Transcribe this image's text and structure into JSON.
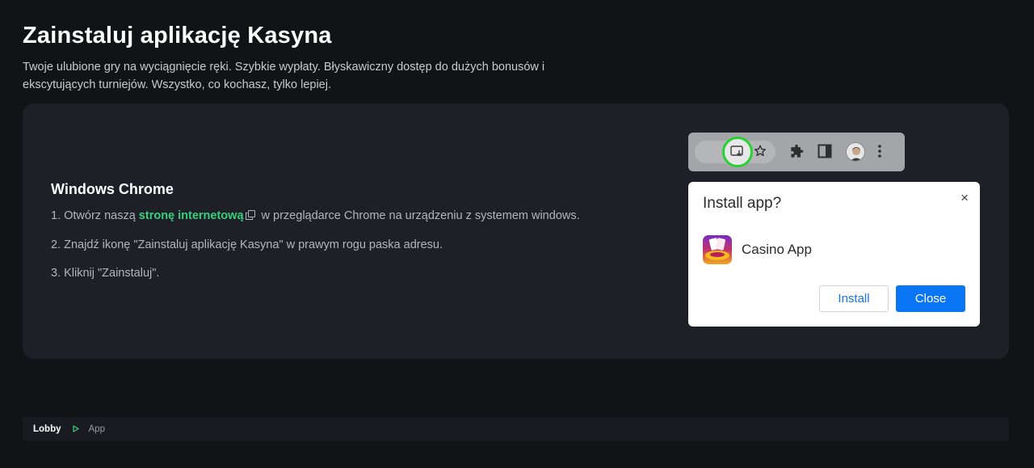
{
  "header": {
    "title": "Zainstaluj aplikację Kasyna",
    "subtitle": "Twoje ulubione gry na wyciągnięcie ręki. Szybkie wypłaty. Błyskawiczny dostęp do dużych bonusów i ekscytujących turniejów. Wszystko, co kochasz, tylko lepiej."
  },
  "instructions": {
    "os_title": "Windows Chrome",
    "step1_prefix": "1. Otwórz naszą ",
    "step1_link": "stronę internetową",
    "step1_suffix": " w przeglądarce Chrome na urządzeniu z systemem windows.",
    "step2": "2. Znajdź ikonę \"Zainstaluj aplikację Kasyna\" w prawym rogu paska adresu.",
    "step3": "3. Kliknij \"Zainstaluj\"."
  },
  "toolbar_icons": [
    "install-app-icon",
    "star-icon",
    "puzzle-icon",
    "sidepanel-icon",
    "avatar",
    "more-menu-icon"
  ],
  "dialog": {
    "title": "Install app?",
    "close_symbol": "×",
    "app_name": "Casino App",
    "install_label": "Install",
    "close_label": "Close"
  },
  "breadcrumb": {
    "home": "Lobby",
    "current": "App"
  },
  "colors": {
    "accent_green": "#35d07f",
    "highlight_ring": "#27d12f",
    "primary_blue": "#0a76f5",
    "background": "#121317",
    "card": "#1f2027"
  }
}
